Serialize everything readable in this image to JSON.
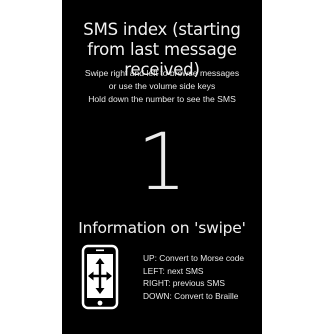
{
  "title": "SMS index (starting from last message received)",
  "instructions": [
    "Swipe right and left to browse messages",
    "or use the volume side keys",
    "Hold down the number to see the SMS"
  ],
  "sms_index": "1",
  "info_heading": "Information on 'swipe'",
  "phone_icon": "phone-with-move-arrows-icon",
  "swipe_actions": [
    "UP: Convert to Morse code",
    "LEFT: next SMS",
    "RIGHT: previous SMS",
    "DOWN: Convert to Braille"
  ],
  "colors": {
    "background": "#000000",
    "text": "#ffffff"
  }
}
